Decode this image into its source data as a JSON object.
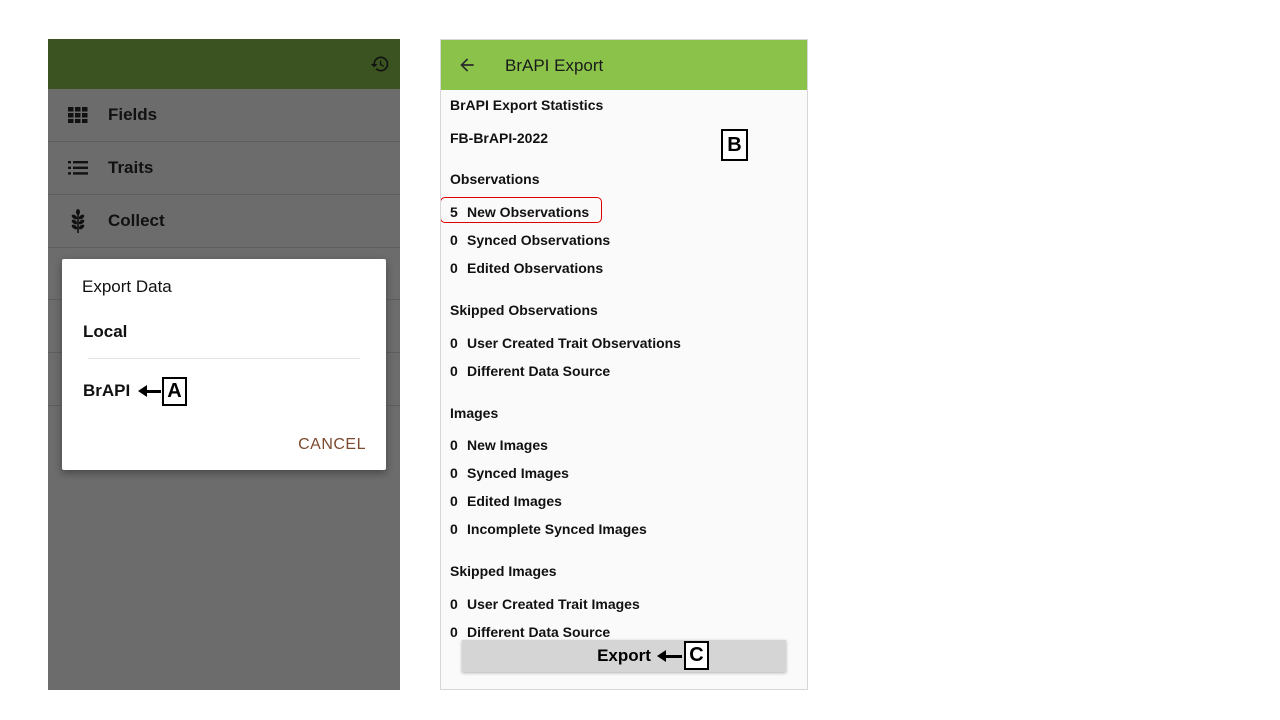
{
  "left_screen": {
    "nav": [
      {
        "label": "Fields",
        "icon": "grid-icon"
      },
      {
        "label": "Traits",
        "icon": "list-icon"
      },
      {
        "label": "Collect",
        "icon": "wheat-icon"
      }
    ],
    "dialog": {
      "title": "Export Data",
      "options": [
        "Local",
        "BrAPI"
      ],
      "cancel_label": "CANCEL"
    }
  },
  "callouts": {
    "a": "A",
    "b": "B",
    "c": "C"
  },
  "right_screen": {
    "title": "BrAPI Export",
    "stats_heading": "BrAPI Export Statistics",
    "study_name": "FB-BrAPI-2022",
    "observations": {
      "heading": "Observations",
      "rows": [
        {
          "count": "5",
          "label": "New Observations"
        },
        {
          "count": "0",
          "label": "Synced Observations"
        },
        {
          "count": "0",
          "label": "Edited Observations"
        }
      ]
    },
    "skipped_observations": {
      "heading": "Skipped Observations",
      "rows": [
        {
          "count": "0",
          "label": "User Created Trait Observations"
        },
        {
          "count": "0",
          "label": "Different Data Source"
        }
      ]
    },
    "images": {
      "heading": "Images",
      "rows": [
        {
          "count": "0",
          "label": "New Images"
        },
        {
          "count": "0",
          "label": "Synced Images"
        },
        {
          "count": "0",
          "label": "Edited Images"
        },
        {
          "count": "0",
          "label": "Incomplete Synced Images"
        }
      ]
    },
    "skipped_images": {
      "heading": "Skipped Images",
      "rows": [
        {
          "count": "0",
          "label": "User Created Trait Images"
        },
        {
          "count": "0",
          "label": "Different Data Source"
        }
      ]
    },
    "export_label": "Export"
  },
  "colors": {
    "left_topbar": "#3b5320",
    "right_appbar": "#8bc34a",
    "cancel_text": "#7b4a2e",
    "highlight": "#e00000"
  }
}
